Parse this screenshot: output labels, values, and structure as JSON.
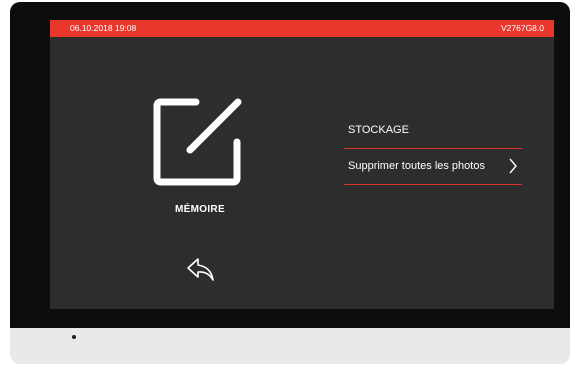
{
  "status": {
    "datetime": "06.10.2018  19:08",
    "version": "V2767G8.0"
  },
  "left_panel": {
    "icon": "edit-square-icon",
    "label": "MÉMOIRE",
    "back_icon": "back-arrow-icon"
  },
  "menu": {
    "items": [
      {
        "label": "STOCKAGE"
      },
      {
        "label": "Supprimer toutes les photos",
        "icon": "chevron-right-icon"
      }
    ]
  },
  "colors": {
    "accent": "#e8382d",
    "screen_bg": "#2d2d2d",
    "bezel": "#0d0d0d",
    "text": "#ffffff"
  }
}
